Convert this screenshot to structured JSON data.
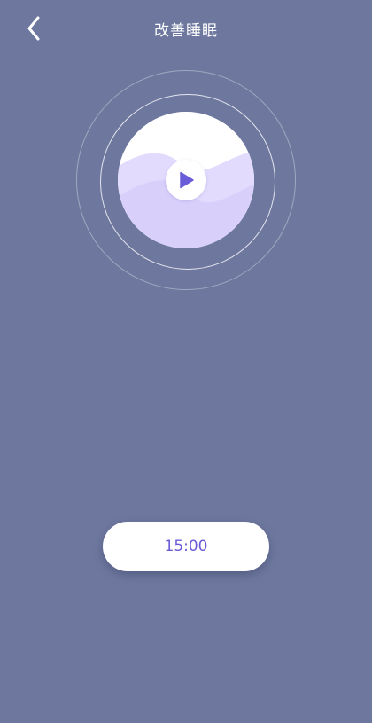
{
  "header": {
    "title": "改善睡眠",
    "back_icon": "chevron-left-icon"
  },
  "player": {
    "play_icon": "play-icon"
  },
  "timer": {
    "label": "15:00"
  },
  "colors": {
    "background": "#6e789f",
    "accent": "#6a5cd8",
    "disc_light": "#ede8ff",
    "disc_mid": "#dcd4fb"
  }
}
